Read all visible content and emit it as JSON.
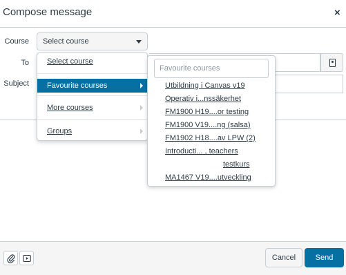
{
  "dialog": {
    "title": "Compose message",
    "close_glyph": "×"
  },
  "form": {
    "course_label": "Course",
    "course_selected": "Select course",
    "to_label": "To",
    "subject_label": "Subject"
  },
  "course_menu": {
    "items": [
      {
        "label": "Select course"
      },
      {
        "label": "Favourite courses",
        "active": true,
        "submenu": true
      },
      {
        "label": "More courses",
        "submenu": true
      },
      {
        "label": "Groups",
        "submenu": true
      }
    ]
  },
  "favourites_menu": {
    "search_placeholder": "Favourite courses",
    "courses": [
      "Utbildning i Canvas v19",
      "Operativ i...nssäkerhet",
      "FM1900 H19....or testing",
      "FM1900 V19....ng (salsa)",
      "FM1902 H18....av LPW (2)",
      "Introducti... , teachers",
      "testkurs",
      "MA1467 V19....utveckling"
    ]
  },
  "footer": {
    "cancel_label": "Cancel",
    "send_label": "Send",
    "attach_icon": "paperclip-icon",
    "media_icon": "media-icon"
  },
  "colors": {
    "accent": "#0770a3",
    "border": "#c7cdd1",
    "text": "#2d3b45"
  }
}
